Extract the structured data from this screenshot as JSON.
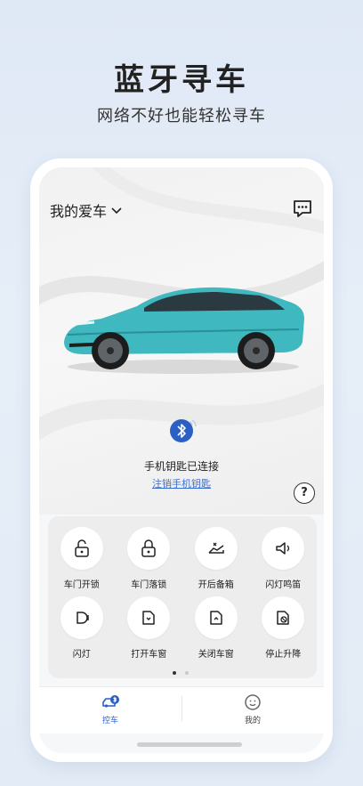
{
  "promo": {
    "title": "蓝牙寻车",
    "subtitle": "网络不好也能轻松寻车"
  },
  "header": {
    "title": "我的爱车",
    "title_icon": "chevron-down-icon",
    "message_icon": "message-icon"
  },
  "key_status": {
    "text": "手机钥匙已连接",
    "revoke_link": "注销手机钥匙",
    "help_label": "?"
  },
  "controls": [
    {
      "label": "车门开锁",
      "icon": "unlock-icon"
    },
    {
      "label": "车门落锁",
      "icon": "lock-icon"
    },
    {
      "label": "开后备箱",
      "icon": "trunk-icon"
    },
    {
      "label": "闪灯鸣笛",
      "icon": "horn-icon"
    },
    {
      "label": "闪灯",
      "icon": "headlight-icon"
    },
    {
      "label": "打开车窗",
      "icon": "window-open-icon"
    },
    {
      "label": "关闭车窗",
      "icon": "window-close-icon"
    },
    {
      "label": "停止升降",
      "icon": "window-stop-icon"
    }
  ],
  "pager": {
    "pages": 2,
    "current": 1
  },
  "tabs": [
    {
      "label": "控车",
      "icon": "car-control-icon",
      "active": true
    },
    {
      "label": "我的",
      "icon": "profile-icon",
      "active": false
    }
  ],
  "colors": {
    "accent": "#3a6fd8",
    "active_tab": "#2a5fc4",
    "car_body": "#3fb8bf"
  }
}
